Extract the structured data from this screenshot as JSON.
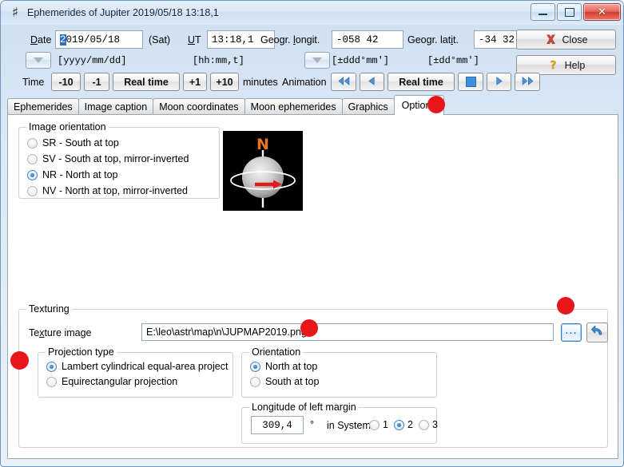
{
  "window": {
    "title": "Ephemerides of Jupiter  2019/05/18  13:18,1",
    "icon": "jupiter-icon",
    "minimize_label": "—",
    "maximize_label": "□",
    "close_label": "✕"
  },
  "header": {
    "date": {
      "label": "Date",
      "label_pre": "D",
      "label_key": "a",
      "label_post": "te",
      "value_selected": "2",
      "value_rest": "019/05/18",
      "weekday": "(Sat)",
      "format_hint": "[yyyy/mm/dd]",
      "dropdown_icon": "chevron-down-icon"
    },
    "ut": {
      "label_pre": "",
      "label_key": "U",
      "label_post": "T",
      "label": "UT",
      "value": "13:18,1",
      "format_hint": "[hh:mm,t]"
    },
    "longitude": {
      "label_pre": "Geogr. ",
      "label_key": "l",
      "label_post": "ongit.",
      "label": "Geogr. longit.",
      "value": "-058 42",
      "format_hint": "[±ddd°mm']",
      "dropdown_icon": "chevron-down-icon"
    },
    "latitude": {
      "label_pre": "Geogr. lat",
      "label_key": "i",
      "label_post": "t.",
      "label": "Geogr. latit.",
      "value": "-34 32",
      "format_hint": "[±dd°mm']"
    },
    "close_button": {
      "label": "Close",
      "icon": "red-x-icon"
    },
    "help_button": {
      "label": "Help",
      "icon": "question-mark-icon"
    },
    "time": {
      "label": "Time",
      "unit_label": "minutes",
      "buttons": [
        "-10",
        "-1",
        "Real time",
        "+1",
        "+10"
      ]
    },
    "animation": {
      "label": "Animation",
      "rewind_fast_icon": "rewind-fast-icon",
      "rewind_icon": "rewind-icon",
      "realtime_label": "Real time",
      "stop_icon": "stop-icon",
      "play_icon": "play-icon",
      "forward_fast_icon": "forward-fast-icon"
    }
  },
  "tabs": [
    {
      "label": "Ephemerides",
      "active": false
    },
    {
      "label": "Image caption",
      "active": false
    },
    {
      "label": "Moon coordinates",
      "active": false
    },
    {
      "label": "Moon ephemerides",
      "active": false
    },
    {
      "label": "Graphics",
      "active": false
    },
    {
      "label": "Options",
      "active": true
    }
  ],
  "options_page": {
    "image_orientation": {
      "title": "Image orientation",
      "items": [
        {
          "label": "SR - South at top",
          "selected": false
        },
        {
          "label": "SV - South at top, mirror-inverted",
          "selected": false
        },
        {
          "label": "NR - North at top",
          "selected": true
        },
        {
          "label": "NV - North at top, mirror-inverted",
          "selected": false
        }
      ]
    },
    "preview": {
      "name": "orientation-preview",
      "north_label": "N",
      "north_color": "#e8761a",
      "arrow_color": "#e01b1b",
      "background": "#000000"
    },
    "texturing": {
      "title": "Texturing",
      "image_label_pre": "Te",
      "image_label_key": "x",
      "image_label_post": "ture image",
      "image_label": "Texture image",
      "image_path": "E:\\leo\\astr\\map\\n\\JUPMAP2019.png",
      "browse_label": "...",
      "reset_icon": "undo-arrow-icon",
      "projection": {
        "title": "Projection type",
        "items": [
          {
            "label": "Lambert cylindrical equal-area projection",
            "selected": true
          },
          {
            "label": "Equirectangular projection",
            "selected": false
          }
        ]
      },
      "orientation": {
        "title": "Orientation",
        "items": [
          {
            "label": "North at top",
            "selected": true
          },
          {
            "label": "South at top",
            "selected": false
          }
        ]
      },
      "longitude_margin": {
        "title": "Longitude of left margin",
        "value": "309,4",
        "degree_symbol": "°",
        "system_label": "in System",
        "systems": [
          {
            "label": "1",
            "selected": false
          },
          {
            "label": "2",
            "selected": true
          },
          {
            "label": "3",
            "selected": false
          }
        ]
      }
    }
  },
  "annotations": {
    "color": "#e8161b",
    "dots": [
      {
        "name": "annotation-dot-options-tab"
      },
      {
        "name": "annotation-dot-texture-path"
      },
      {
        "name": "annotation-dot-browse-button"
      },
      {
        "name": "annotation-dot-projection-type"
      }
    ]
  }
}
